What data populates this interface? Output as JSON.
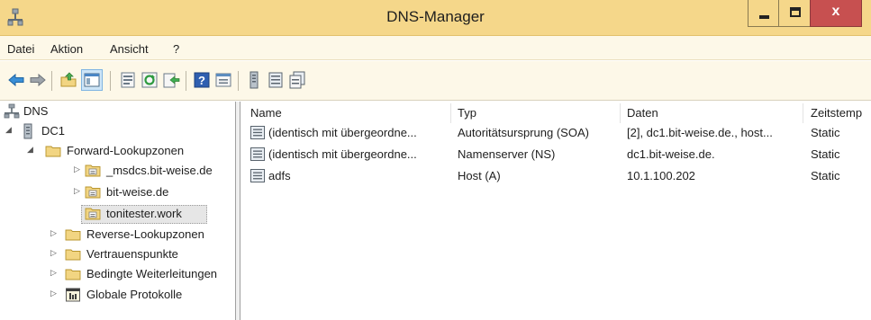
{
  "window": {
    "title": "DNS-Manager",
    "close_glyph": "x"
  },
  "menu": {
    "items": [
      "Datei",
      "Aktion",
      "Ansicht",
      "?"
    ]
  },
  "toolbar": {
    "icons": [
      "back-arrow-icon",
      "forward-arrow-icon",
      "up-folder-icon",
      "show-tree-icon",
      "properties-icon",
      "refresh-icon",
      "export-list-icon",
      "help-icon",
      "details-view-icon",
      "server-icon",
      "record-icon",
      "copy-record-icon"
    ]
  },
  "tree": {
    "root": "DNS",
    "server": "DC1",
    "forward_zones": "Forward-Lookupzonen",
    "zones": [
      "_msdcs.bit-weise.de",
      "bit-weise.de",
      "tonitester.work"
    ],
    "reverse_zones": "Reverse-Lookupzonen",
    "trust_points": "Vertrauenspunkte",
    "conditional_forwarders": "Bedingte Weiterleitungen",
    "global_logs": "Globale Protokolle",
    "arrows": {
      "expanded": "◢",
      "collapsed": "▷"
    }
  },
  "list": {
    "columns": [
      "Name",
      "Typ",
      "Daten",
      "Zeitstemp"
    ],
    "rows": [
      {
        "name": "(identisch mit übergeordne...",
        "type": "Autoritätsursprung (SOA)",
        "data": "[2], dc1.bit-weise.de., host...",
        "timestamp": "Static"
      },
      {
        "name": "(identisch mit übergeordne...",
        "type": "Namenserver (NS)",
        "data": "dc1.bit-weise.de.",
        "timestamp": "Static"
      },
      {
        "name": "adfs",
        "type": "Host (A)",
        "data": "10.1.100.202",
        "timestamp": "Static"
      }
    ]
  },
  "colors": {
    "titlebar": "#f5d78a",
    "close_button": "#c75050",
    "toolbar_bg": "#fdf8e8",
    "folder": "#f2d582",
    "selection": "#e6e6e6"
  }
}
